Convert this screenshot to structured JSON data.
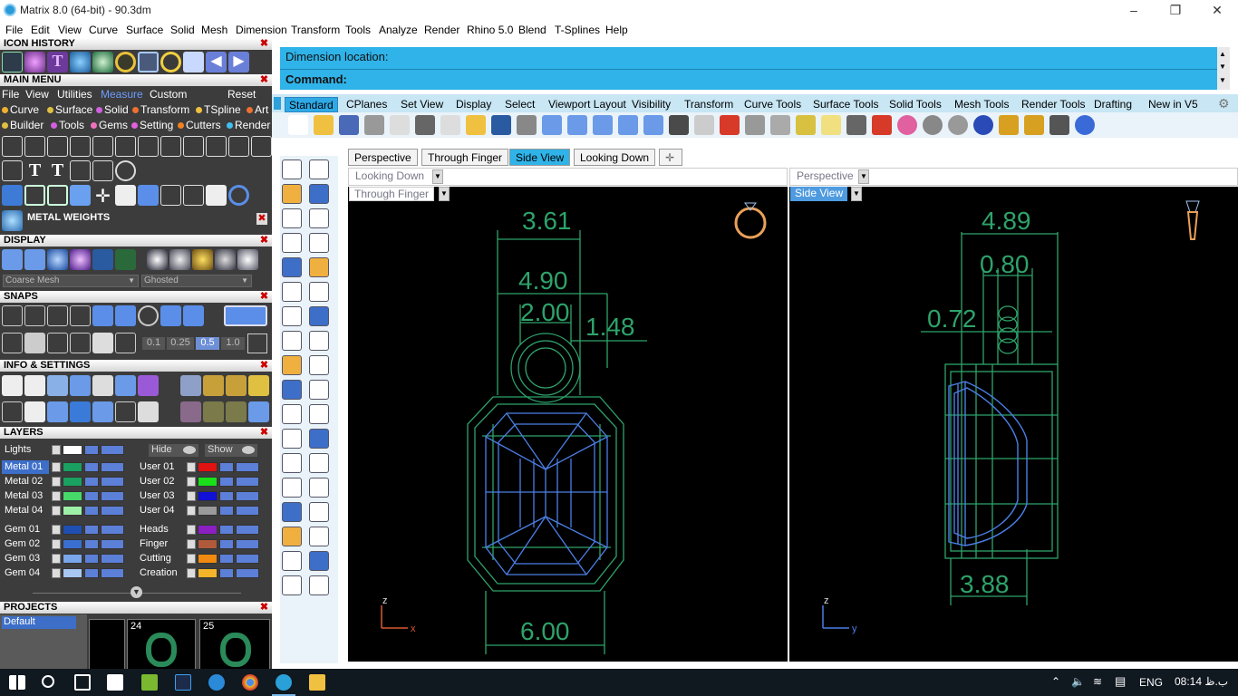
{
  "window": {
    "title": "Matrix 8.0 (64-bit) - 90.3dm"
  },
  "menu": [
    "File",
    "Edit",
    "View",
    "Curve",
    "Surface",
    "Solid",
    "Mesh",
    "Dimension",
    "Transform",
    "Tools",
    "Analyze",
    "Render",
    "Rhino 5.0",
    "Blend",
    "T-Splines",
    "Help"
  ],
  "panels": {
    "icon_history": "ICON HISTORY",
    "main_menu": "MAIN MENU",
    "metal_weights": "METAL WEIGHTS",
    "display": "DISPLAY",
    "snaps": "SNAPS",
    "info_settings": "INFO & SETTINGS",
    "layers": "LAYERS",
    "projects": "PROJECTS"
  },
  "main_menu": {
    "top": [
      "File",
      "View",
      "Utilities",
      "Measure",
      "Custom"
    ],
    "reset": "Reset",
    "row2": [
      "Curve",
      "Surface",
      "Solid",
      "Transform",
      "TSpline",
      "Art"
    ],
    "row3": [
      "Builder",
      "Tools",
      "Gems",
      "Setting",
      "Cutters",
      "Render"
    ]
  },
  "display": {
    "mesh": "Coarse Mesh",
    "mode": "Ghosted"
  },
  "snaps_values": [
    "0.1",
    "0.25",
    "0.5",
    "1.0"
  ],
  "layers": {
    "lights": "Lights",
    "hide": "Hide",
    "show": "Show",
    "left": [
      {
        "name": "Metal 01",
        "color": "#1aa060",
        "selected": true
      },
      {
        "name": "Metal 02",
        "color": "#1aa060",
        "selected": false
      },
      {
        "name": "Metal 03",
        "color": "#47d86a",
        "selected": false
      },
      {
        "name": "Metal 04",
        "color": "#9ef0a8",
        "selected": false
      },
      {
        "name": "Gem 01",
        "color": "#1f4fb3",
        "selected": false
      },
      {
        "name": "Gem 02",
        "color": "#3a6fd1",
        "selected": false
      },
      {
        "name": "Gem 03",
        "color": "#7aa6ec",
        "selected": false
      },
      {
        "name": "Gem 04",
        "color": "#a9c7f3",
        "selected": false
      }
    ],
    "right": [
      {
        "name": "User 01",
        "color": "#e01212"
      },
      {
        "name": "User 02",
        "color": "#19e019"
      },
      {
        "name": "User 03",
        "color": "#1010d6"
      },
      {
        "name": "User 04",
        "color": "#9a9a9a"
      },
      {
        "name": "Heads",
        "color": "#8b1fc2"
      },
      {
        "name": "Finger",
        "color": "#b05a3c"
      },
      {
        "name": "Cutting",
        "color": "#f08a10"
      },
      {
        "name": "Creation",
        "color": "#f5b52a"
      }
    ]
  },
  "projects": {
    "default": "Default",
    "thumbs": [
      "24",
      "25"
    ]
  },
  "command": {
    "line1": "Dimension location:",
    "line2": "Command:"
  },
  "tabs": [
    "Standard",
    "CPlanes",
    "Set View",
    "Display",
    "Select",
    "Viewport Layout",
    "Visibility",
    "Transform",
    "Curve Tools",
    "Surface Tools",
    "Solid Tools",
    "Mesh Tools",
    "Render Tools",
    "Drafting",
    "New in V5"
  ],
  "viewport_tabs": [
    "Perspective",
    "Through Finger",
    "Side View",
    "Looking Down"
  ],
  "viewports": {
    "left": {
      "top_label": "Looking Down",
      "label": "Through Finger",
      "dims": [
        "3.61",
        "4.90",
        "2.00",
        "1.48",
        "6.00"
      ],
      "axes": [
        "z",
        "x"
      ]
    },
    "right": {
      "top_label": "Perspective",
      "label": "Side View",
      "dims": [
        "4.89",
        "0.80",
        "0.72",
        "3.88"
      ],
      "axes": [
        "z",
        "y"
      ]
    }
  },
  "taskbar": {
    "lang": "ENG",
    "time": "08:14 ب.ظ"
  }
}
